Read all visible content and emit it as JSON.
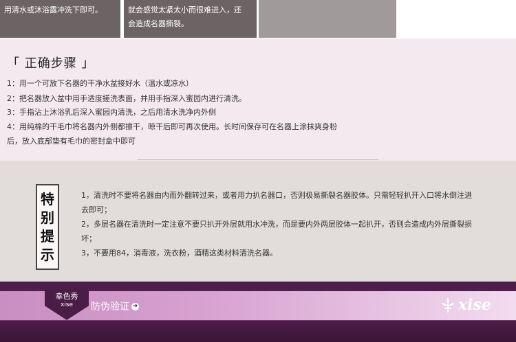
{
  "top": {
    "box1": "用清水或沐浴露冲洗下即可。",
    "box2_line1": "就会感觉太紧太小而很难进入，还",
    "box2_line2": "会造成名器撕裂。"
  },
  "steps": {
    "title": "「 正确步骤 」",
    "items": [
      "1：用一个可放下名器的干净水盆接好水（温水或凉水）",
      "2：把名器放入盆中用手适度搓洗表面，并用手指深入蜜园内进行清洗。",
      "3：手指沾上沐浴乳后深入蜜园内清洗，之后用清水洗净内外侧",
      "4：用纯棉的干毛巾将名器内外侧都擦干，晾干后即可再次使用。长时间保存可在名器上涂抹爽身粉",
      "后，放入底部垫有毛巾的密封盒中即可"
    ]
  },
  "tips": {
    "badge": [
      "特",
      "别",
      "提",
      "示"
    ],
    "lines": [
      "1，清洗时不要将名器由内而外翻转过来，或者用力扒名器口，否则极易撕裂名器胶体。只需轻轻扒开入口将水倒注进",
      "去即可；",
      "2，多层名器在清洗时一定注意不要只扒开外层就用水冲洗，而是要内外两层胶体一起扒开，否则会造成内外层撕裂损",
      "坏；",
      "3，不要用84，消毒液，洗衣粉，酒精这类材料清洗名器。"
    ]
  },
  "banner": {
    "tag_title": "幸色秀",
    "tag_sub": "xise",
    "verify_label": "防伪验证",
    "logo_text": "xise"
  }
}
